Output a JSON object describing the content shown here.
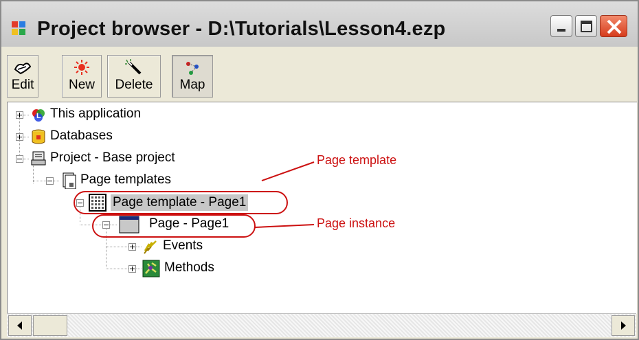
{
  "window": {
    "title": "Project browser - D:\\Tutorials\\Lesson4.ezp",
    "controls": [
      "minimize-icon",
      "maximize-icon",
      "close-icon"
    ]
  },
  "toolbar": {
    "edit_label": "Edit",
    "new_label": "New",
    "delete_label": "Delete",
    "map_label": "Map"
  },
  "tree": {
    "this_application": "This application",
    "databases": "Databases",
    "project": "Project - Base project",
    "page_templates": "Page templates",
    "page_template_page1": "Page template - Page1",
    "page_page1": "Page - Page1",
    "events": "Events",
    "methods": "Methods"
  },
  "annotations": {
    "page_template": "Page template",
    "page_instance": "Page instance",
    "color": "#cc1111"
  },
  "colors": {
    "selection": "#c7c7c7",
    "close_button": "#d63c1c"
  }
}
